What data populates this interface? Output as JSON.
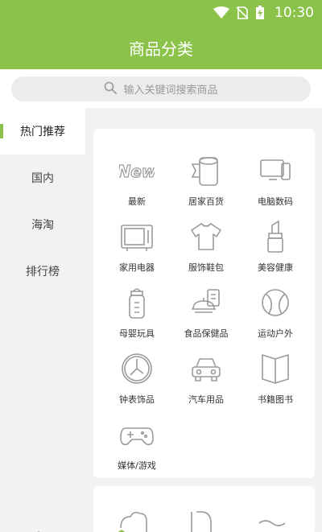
{
  "status": {
    "time": "10:30"
  },
  "header": {
    "title": "商品分类"
  },
  "search": {
    "placeholder": "输入关键词搜索商品"
  },
  "sidebar": {
    "items": [
      {
        "label": "热门推荐",
        "active": true
      },
      {
        "label": "国内",
        "active": false
      },
      {
        "label": "海淘",
        "active": false
      },
      {
        "label": "排行榜",
        "active": false
      }
    ]
  },
  "categories": [
    {
      "label": "最新",
      "icon": "new-icon"
    },
    {
      "label": "居家百货",
      "icon": "tissue-roll-icon"
    },
    {
      "label": "电脑数码",
      "icon": "computer-icon"
    },
    {
      "label": "家用电器",
      "icon": "tv-icon"
    },
    {
      "label": "服饰鞋包",
      "icon": "tshirt-icon"
    },
    {
      "label": "美容健康",
      "icon": "lipstick-icon"
    },
    {
      "label": "母婴玩具",
      "icon": "baby-bottle-icon"
    },
    {
      "label": "食品保健品",
      "icon": "food-icon"
    },
    {
      "label": "运动户外",
      "icon": "ball-icon"
    },
    {
      "label": "钟表饰品",
      "icon": "clock-icon"
    },
    {
      "label": "汽车用品",
      "icon": "car-icon"
    },
    {
      "label": "书籍图书",
      "icon": "book-icon"
    },
    {
      "label": "媒体/游戏",
      "icon": "gamepad-icon"
    }
  ],
  "colors": {
    "brand": "#8bc34a",
    "icon_stroke": "#9a9a9a"
  }
}
